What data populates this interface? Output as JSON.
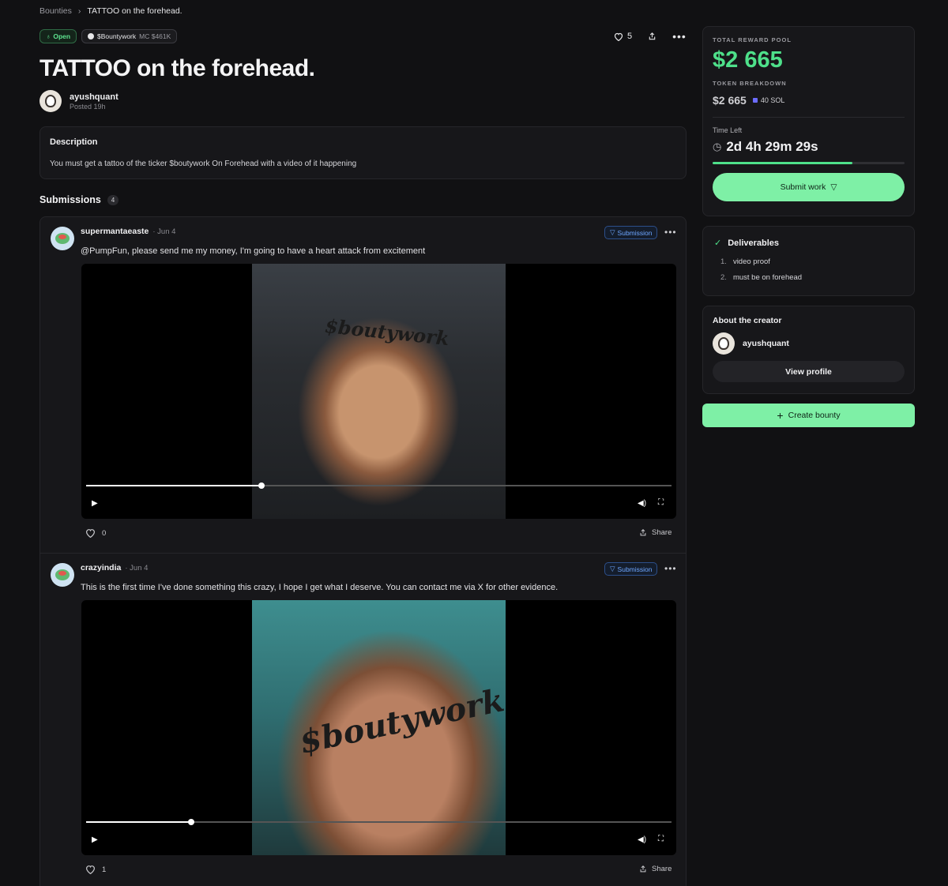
{
  "breadcrumb": {
    "root": "Bounties",
    "current": "TATTOO on the forehead."
  },
  "badges": {
    "status": "Open",
    "token_name": "$Bountywork",
    "token_mc": "MC $461K"
  },
  "actions": {
    "likes": "5"
  },
  "bounty": {
    "title": "TATTOO on the forehead.",
    "author": "ayushquant",
    "posted": "Posted 19h",
    "description_label": "Description",
    "description": "You must get a tattoo of the ticker $boutywork On Forehead with a video of it happening"
  },
  "submissions": {
    "label": "Submissions",
    "count": "4",
    "items": [
      {
        "user": "supermantaeaste",
        "date": "· Jun 4",
        "pill": "Submission",
        "text": "@PumpFun, please send me my money, I'm going to have a heart attack from excitement",
        "tattoo_text": "$boutywork",
        "progress": 0.3,
        "likes": "0",
        "share": "Share"
      },
      {
        "user": "crazyindia",
        "date": "· Jun 4",
        "pill": "Submission",
        "text": "This is the first time I've done something this crazy, I hope I get what I deserve. You can contact me via X for other evidence.",
        "tattoo_text": "$boutywork",
        "progress": 0.18,
        "likes": "1",
        "share": "Share"
      }
    ]
  },
  "sidebar": {
    "pool_label": "TOTAL REWARD POOL",
    "pool_value": "$2 665",
    "breakdown_label": "TOKEN BREAKDOWN",
    "breakdown_value": "$2 665",
    "breakdown_sol": "40 SOL",
    "time_left_label": "Time Left",
    "time_left_value": "2d 4h 29m 29s",
    "time_progress": 0.73,
    "submit_label": "Submit work",
    "deliverables_label": "Deliverables",
    "deliverables": [
      {
        "n": "1.",
        "text": "video proof"
      },
      {
        "n": "2.",
        "text": "must be on forehead"
      }
    ],
    "about_label": "About the creator",
    "creator": "ayushquant",
    "view_profile": "View profile",
    "create_bounty": "Create bounty"
  },
  "colors": {
    "accent_green": "#4ee08a",
    "button_green": "#7ef0a6",
    "submission_blue": "#6ea6ff"
  }
}
